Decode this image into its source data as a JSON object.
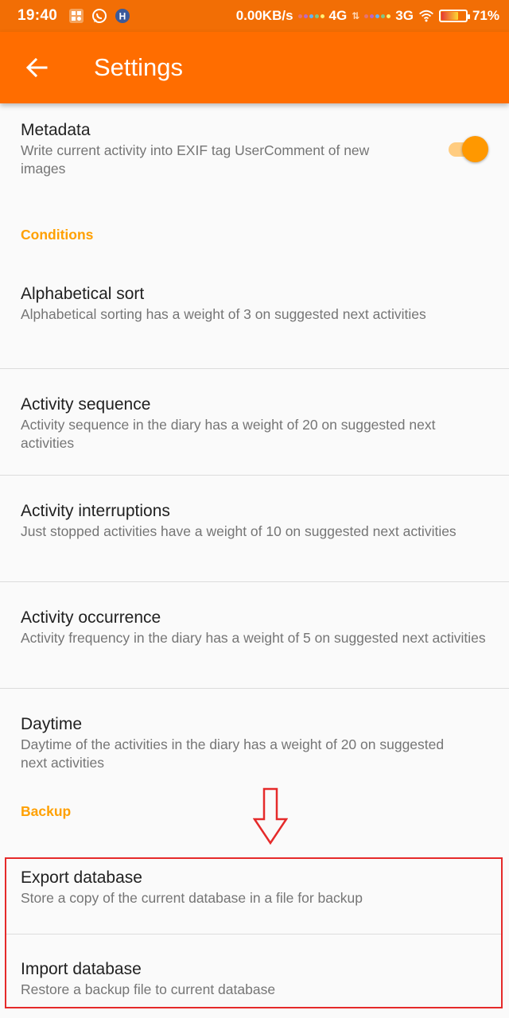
{
  "status_bar": {
    "time": "19:40",
    "network_speed": "0.00KB/s",
    "sim1_type": "4G",
    "sim2_type": "3G",
    "battery": "71%",
    "battery_level": 0.71
  },
  "toolbar": {
    "title": "Settings"
  },
  "metadata": {
    "title": "Metadata",
    "summary": "Write current activity into EXIF tag UserComment of new images",
    "enabled": true
  },
  "categories": {
    "conditions": "Conditions",
    "backup": "Backup"
  },
  "conditions": [
    {
      "title": "Alphabetical sort",
      "summary": "Alphabetical sorting has a weight of 3 on suggested next activities"
    },
    {
      "title": "Activity sequence",
      "summary": "Activity sequence in the diary has a weight of 20 on suggested next activities"
    },
    {
      "title": "Activity interruptions",
      "summary": "Just stopped activities have a weight of 10 on suggested next activities"
    },
    {
      "title": "Activity occurrence",
      "summary": "Activity frequency in the diary has a weight of 5 on suggested next activities"
    },
    {
      "title": "Daytime",
      "summary": "Daytime of the activities in the diary has a weight of 20 on suggested next activities"
    }
  ],
  "backup": [
    {
      "title": "Export database",
      "summary": "Store a copy of the current database in a file for backup"
    },
    {
      "title": "Import database",
      "summary": "Restore a backup file to current database"
    }
  ],
  "colors": {
    "toolbar": "#ff6d00",
    "accent": "#ff9800",
    "category": "#ffa000",
    "annotation": "#e52a2a"
  }
}
